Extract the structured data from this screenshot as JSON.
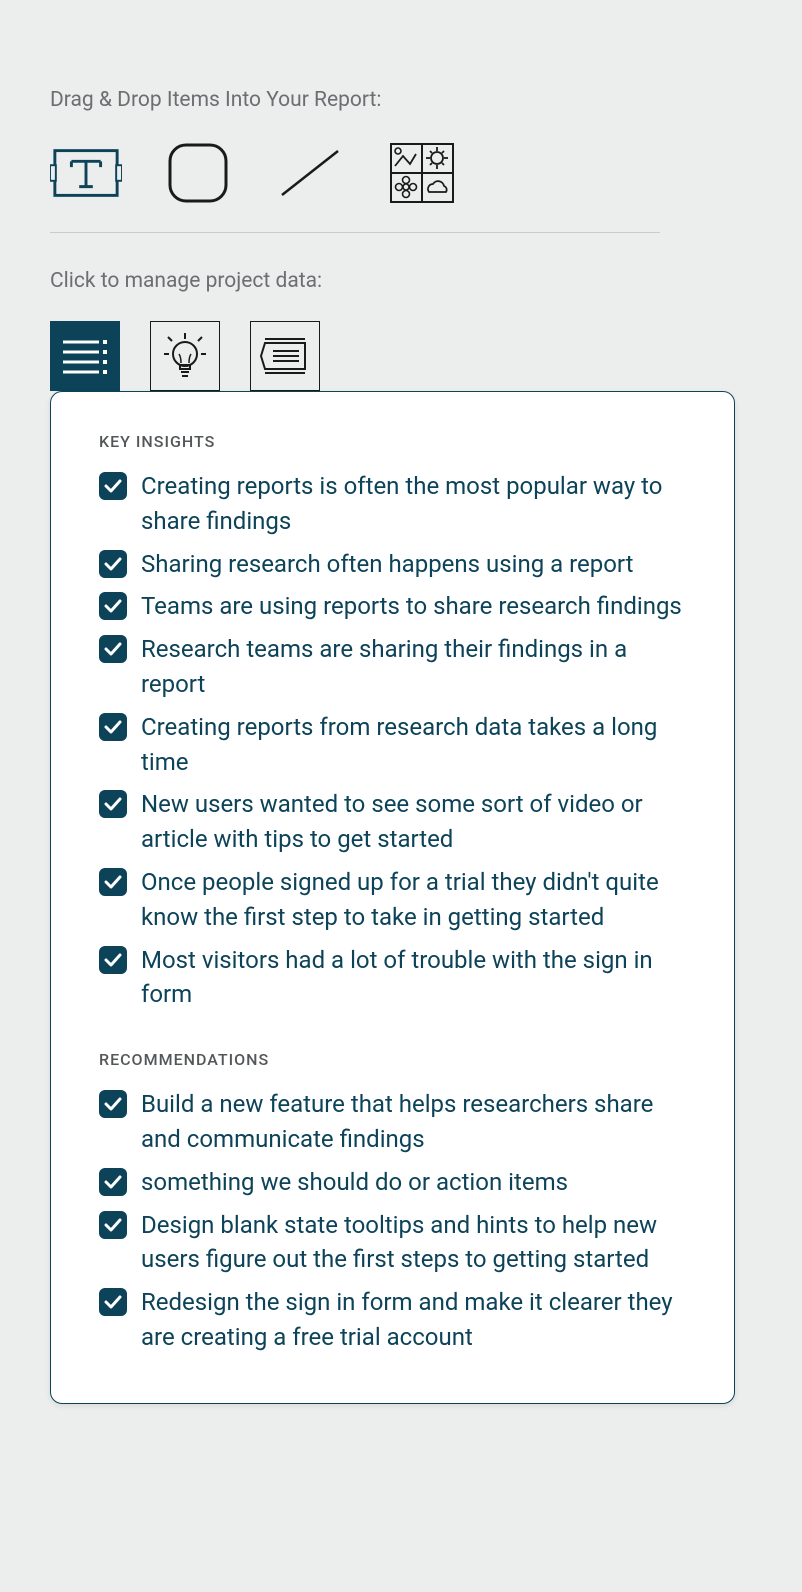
{
  "labels": {
    "drag_drop": "Drag & Drop Items Into Your Report:",
    "manage_data": "Click to manage project data:"
  },
  "toolbar_icons": [
    {
      "name": "text-box-icon"
    },
    {
      "name": "rounded-rectangle-icon"
    },
    {
      "name": "line-icon"
    },
    {
      "name": "images-grid-icon"
    }
  ],
  "tabs": [
    {
      "name": "list-view-tab",
      "active": true,
      "icon": "list-icon"
    },
    {
      "name": "ideas-tab",
      "active": false,
      "icon": "lightbulb-icon"
    },
    {
      "name": "notes-tab",
      "active": false,
      "icon": "presentation-icon"
    }
  ],
  "panel": {
    "groups": [
      {
        "heading": "KEY INSIGHTS",
        "items": [
          {
            "checked": true,
            "text": "Creating reports is often the most popular way to share findings"
          },
          {
            "checked": true,
            "text": "Sharing research often happens using a report"
          },
          {
            "checked": true,
            "text": "Teams are using reports to share research findings"
          },
          {
            "checked": true,
            "text": "Research teams are sharing their findings in a report"
          },
          {
            "checked": true,
            "text": "Creating reports from research data takes a long time"
          },
          {
            "checked": true,
            "text": "New users wanted to see some sort of video or article with tips to get started"
          },
          {
            "checked": true,
            "text": "Once people signed up for a trial they didn't quite know the first step to take in getting started"
          },
          {
            "checked": true,
            "text": "Most visitors had a lot of trouble with the sign in form"
          }
        ]
      },
      {
        "heading": "RECOMMENDATIONS",
        "items": [
          {
            "checked": true,
            "text": "Build a new feature that helps researchers share and communicate findings"
          },
          {
            "checked": true,
            "text": "something we should do or action items"
          },
          {
            "checked": true,
            "text": "Design blank state tooltips and hints to help new users figure out the first steps to getting started"
          },
          {
            "checked": true,
            "text": "Redesign the sign in form and make it clearer they are creating a free trial account"
          }
        ]
      }
    ]
  },
  "colors": {
    "primary": "#0d4359",
    "background": "#eceded",
    "text_muted": "#6b6f72",
    "heading_muted": "#545759"
  }
}
